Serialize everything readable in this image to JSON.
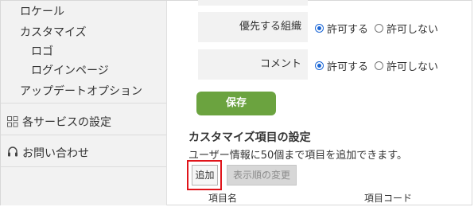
{
  "sidebar": {
    "items": [
      {
        "label": "ロケール"
      },
      {
        "label": "カスタマイズ"
      },
      {
        "label": "ロゴ"
      },
      {
        "label": "ログインページ"
      },
      {
        "label": "アップデートオプション"
      }
    ],
    "service_settings": "各サービスの設定",
    "contact": "お問い合わせ"
  },
  "settings": {
    "priority_org": {
      "label": "優先する組織",
      "options": [
        "許可する",
        "許可しない"
      ],
      "selected": "許可する"
    },
    "comment": {
      "label": "コメント",
      "options": [
        "許可する",
        "許可しない"
      ],
      "selected": "許可する"
    }
  },
  "save_button": "保存",
  "custom_section": {
    "title": "カスタマイズ項目の設定",
    "description": "ユーザー情報に50個まで項目を追加できます。",
    "add_button": "追加",
    "order_button": "表示順の変更",
    "columns": [
      "項目名",
      "項目コード"
    ]
  },
  "colors": {
    "save_green": "#6ba33f",
    "highlight_red": "#e0141a",
    "radio_blue": "#1a66d6",
    "sidebar_bg": "#f2f2f2"
  }
}
